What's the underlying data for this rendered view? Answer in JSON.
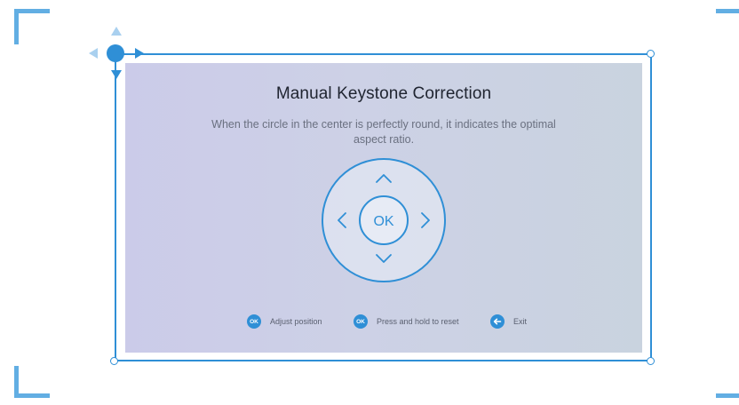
{
  "screen": {
    "title": "Manual Keystone Correction",
    "subtitle": "When the circle in the center is perfectly round, it indicates the optimal aspect ratio."
  },
  "dpad": {
    "ok_label": "OK",
    "up_icon": "chevron-up-icon",
    "down_icon": "chevron-down-icon",
    "left_icon": "chevron-left-icon",
    "right_icon": "chevron-right-icon"
  },
  "hints": [
    {
      "badge": "OK",
      "label": "Adjust position"
    },
    {
      "badge": "OK",
      "label": "Press and hold to reset"
    },
    {
      "badge_icon": "back-arrow-icon",
      "label": "Exit"
    }
  ],
  "colors": {
    "accent": "#2f8fd6",
    "corner_marker": "#62aee3",
    "panel_left": "#cbcbe9",
    "panel_right": "#c9d3df"
  }
}
